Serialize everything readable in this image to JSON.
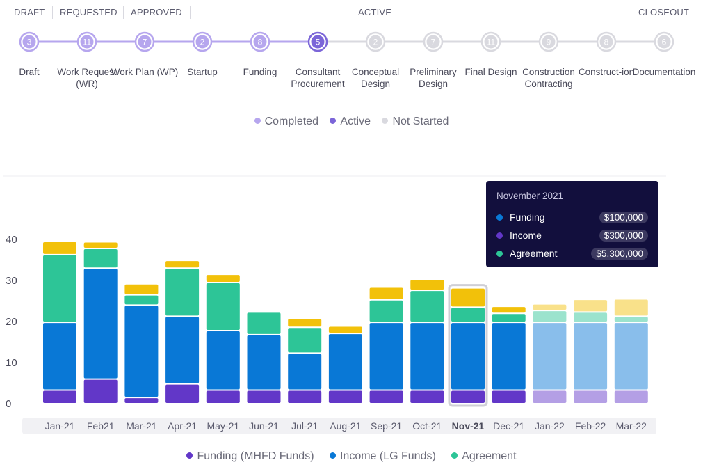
{
  "phases": [
    {
      "label": "DRAFT"
    },
    {
      "label": "REQUESTED"
    },
    {
      "label": "APPROVED"
    },
    {
      "label": "ACTIVE"
    },
    {
      "label": "CLOSEOUT"
    }
  ],
  "steps": [
    {
      "count": "3",
      "label": "Draft",
      "status": "completed"
    },
    {
      "count": "11",
      "label": "Work Request (WR)",
      "status": "completed"
    },
    {
      "count": "7",
      "label": "Work Plan (WP)",
      "status": "completed"
    },
    {
      "count": "2",
      "label": "Startup",
      "status": "completed"
    },
    {
      "count": "8",
      "label": "Funding",
      "status": "completed"
    },
    {
      "count": "5",
      "label": "Consultant Procurement",
      "status": "active"
    },
    {
      "count": "2",
      "label": "Conceptual Design",
      "status": "not-started"
    },
    {
      "count": "7",
      "label": "Preliminary Design",
      "status": "not-started"
    },
    {
      "count": "11",
      "label": "Final Design",
      "status": "not-started"
    },
    {
      "count": "9",
      "label": "Construction Contracting",
      "status": "not-started"
    },
    {
      "count": "8",
      "label": "Construct-ion",
      "status": "not-started"
    },
    {
      "count": "6",
      "label": "Documentation",
      "status": "not-started"
    }
  ],
  "status_legend": {
    "completed": "Completed",
    "active": "Active",
    "not_started": "Not Started"
  },
  "colors": {
    "completed": "#b6a6ee",
    "active": "#7b65d8",
    "not_started": "#d9d9df",
    "funding": "#6237c8",
    "income": "#0978d6",
    "agreement": "#2dc597",
    "other": "#f2c10a"
  },
  "tooltip": {
    "title": "November 2021",
    "rows": [
      {
        "label": "Funding",
        "value": "$100,000",
        "color": "#0978d6"
      },
      {
        "label": "Income",
        "value": "$300,000",
        "color": "#6237c8"
      },
      {
        "label": "Agreement",
        "value": "$5,300,000",
        "color": "#2dc597"
      }
    ]
  },
  "series_legend": [
    {
      "label": "Funding (MHFD Funds)",
      "color": "#6237c8"
    },
    {
      "label": "Income (LG Funds)",
      "color": "#0978d6"
    },
    {
      "label": "Agreement",
      "color": "#2dc597"
    }
  ],
  "chart_data": {
    "type": "bar",
    "stacked": true,
    "categories": [
      "Jan-21",
      "Feb21",
      "Mar-21",
      "Apr-21",
      "May-21",
      "Jun-21",
      "Jul-21",
      "Aug-21",
      "Sep-21",
      "Oct-21",
      "Nov-21",
      "Dec-21",
      "Jan-22",
      "Feb-22",
      "Mar-22"
    ],
    "highlighted_category": "Nov-21",
    "projected_from": "Jan-22",
    "yticks": [
      0,
      10,
      20,
      30,
      40
    ],
    "ylim": [
      0,
      50
    ],
    "series": [
      {
        "name": "Funding (MHFD Funds)",
        "values": [
          3.3,
          6,
          1.5,
          4.8,
          3.3,
          3.3,
          3.3,
          3.3,
          3.3,
          3.3,
          3.3,
          3.3,
          3.3,
          3.3,
          3.3
        ]
      },
      {
        "name": "Income (LG Funds)",
        "values": [
          16.5,
          27,
          22.5,
          16.5,
          14.5,
          13.5,
          9,
          13.8,
          16.5,
          16.5,
          16.5,
          16.5,
          16.5,
          16.5,
          16.5
        ]
      },
      {
        "name": "Agreement",
        "values": [
          16.5,
          4.8,
          2.5,
          11.7,
          11.7,
          5.5,
          6.3,
          0,
          5.5,
          7.8,
          3.7,
          2.2,
          2.9,
          2.5,
          1.5
        ]
      },
      {
        "values": [
          3.2,
          1.6,
          2.7,
          1.9,
          2,
          0,
          2.2,
          1.8,
          3.1,
          2.7,
          4.7,
          1.7,
          1.6,
          3.1,
          4.2
        ]
      }
    ]
  }
}
